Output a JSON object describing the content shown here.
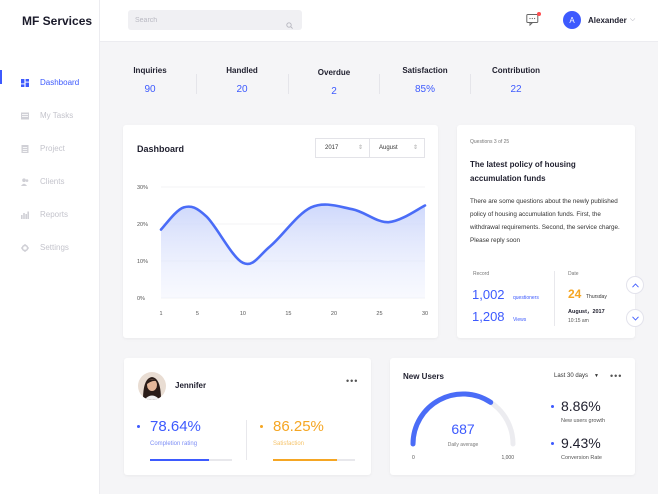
{
  "app": {
    "title": "MF Services"
  },
  "sidebar": {
    "items": [
      {
        "label": "Dashboard",
        "icon": "dashboard-icon",
        "active": true
      },
      {
        "label": "My Tasks",
        "icon": "tasks-icon",
        "active": false
      },
      {
        "label": "Project",
        "icon": "project-icon",
        "active": false
      },
      {
        "label": "Clients",
        "icon": "clients-icon",
        "active": false
      },
      {
        "label": "Reports",
        "icon": "reports-icon",
        "active": false
      },
      {
        "label": "Settings",
        "icon": "settings-icon",
        "active": false
      }
    ]
  },
  "header": {
    "search_placeholder": "Search",
    "user_initial": "A",
    "user_name": "Alexander"
  },
  "stats": [
    {
      "label": "Inquiries",
      "value": "90"
    },
    {
      "label": "Handled",
      "value": "20"
    },
    {
      "label": "Overdue",
      "value": "2"
    },
    {
      "label": "Satisfaction",
      "value": "85%"
    },
    {
      "label": "Contribution",
      "value": "22"
    }
  ],
  "dashboard": {
    "title": "Dashboard",
    "year": "2017",
    "month": "August"
  },
  "chart_data": {
    "type": "area",
    "x": [
      1,
      5,
      10,
      15,
      20,
      25,
      30
    ],
    "y_ticks": [
      "30%",
      "20%",
      "10%",
      "0%"
    ],
    "x_ticks": [
      "1",
      "5",
      "10",
      "15",
      "20",
      "25",
      "30"
    ],
    "ylim": [
      0,
      30
    ],
    "points": [
      {
        "x": 1,
        "y": 18.5
      },
      {
        "x": 3.5,
        "y": 24.5
      },
      {
        "x": 6,
        "y": 22
      },
      {
        "x": 10,
        "y": 9.5
      },
      {
        "x": 13,
        "y": 14
      },
      {
        "x": 17.5,
        "y": 24.5
      },
      {
        "x": 22,
        "y": 24
      },
      {
        "x": 26,
        "y": 20.5
      },
      {
        "x": 30,
        "y": 25
      }
    ],
    "color": "#4a6cf7",
    "grid": true
  },
  "question": {
    "count": "Questions 3 of 25",
    "title": "The latest policy of housing accumulation funds",
    "body": "There are some questions about the newly published policy of housing accumulation funds. First, the withdrawal requirements. Second, the service charge. Please reply soon",
    "record_label": "Record",
    "date_label": "Date",
    "questioners_value": "1,002",
    "questioners_label": "questioners",
    "views_value": "1,208",
    "views_label": "Views",
    "day": "24",
    "weekday": "Thursday",
    "month_year": "August，2017",
    "time": "10:15 am"
  },
  "jennifer": {
    "name": "Jennifer",
    "completion_value": "78.64%",
    "completion_label": "Completion rating",
    "completion_fraction": 0.72,
    "satisfaction_value": "86.25%",
    "satisfaction_label": "Satisfaction",
    "satisfaction_fraction": 0.78,
    "blue": "#3d5afe",
    "orange": "#f5a623"
  },
  "new_users": {
    "title": "New Users",
    "range": "Last 30 days",
    "gauge_value": "687",
    "gauge_label": "Daily average",
    "gauge_min": "0",
    "gauge_max": "1,000",
    "gauge_fraction": 0.687,
    "growth_value": "8.86%",
    "growth_label": "New users growth",
    "conversion_value": "9.43%",
    "conversion_label": "Conversion Rate"
  }
}
